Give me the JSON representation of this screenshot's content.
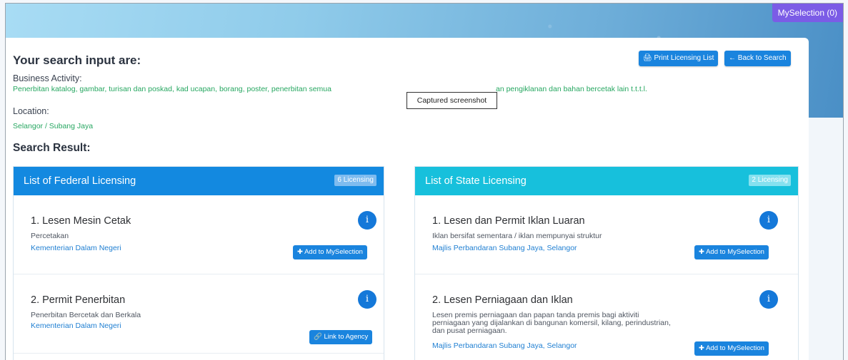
{
  "header": {
    "myselection": "MySelection (0)"
  },
  "search": {
    "title": "Your search input are:",
    "business_label": "Business Activity:",
    "business_value": "Penerbitan katalog, gambar, turisan dan poskad, kad ucapan, borang, poster, penerbitan semua",
    "business_value_end": "an pengiklanan dan bahan bercetak lain t.t.t.l.",
    "location_label": "Location:",
    "location_value": "Selangor / Subang Jaya",
    "print_button": "Print Licensing List",
    "back_button": "← Back to Search",
    "tooltip": "Captured screenshot",
    "result_title": "Search Result:"
  },
  "federal": {
    "title": "List of Federal Licensing",
    "count": "6 Licensing",
    "items": [
      {
        "name": "1. Lesen Mesin Cetak",
        "desc": "Percetakan",
        "agency": "Kementerian Dalam Negeri",
        "action": "Add to MySelection"
      },
      {
        "name": "2. Permit Penerbitan",
        "desc": "Penerbitan Bercetak dan Berkala",
        "agency": "Kementerian Dalam Negeri",
        "action": "Link to Agency"
      }
    ]
  },
  "state": {
    "title": "List of State Licensing",
    "count": "2 Licensing",
    "items": [
      {
        "name": "1. Lesen dan Permit Iklan Luaran",
        "desc": "Iklan bersifat sementara / iklan mempunyai struktur",
        "agency": "Majlis Perbandaran Subang Jaya, Selangor",
        "action": "Add to MySelection"
      },
      {
        "name": "2. Lesen Perniagaan dan Iklan",
        "desc": "Lesen premis perniagaan dan papan tanda premis bagi aktiviti perniagaan yang dijalankan di bangunan komersil, kilang, perindustrian, dan pusat perniagaan.",
        "agency": "Majlis Perbandaran Subang Jaya, Selangor",
        "action": "Add to MySelection"
      }
    ]
  },
  "icons": {
    "info": "info-icon",
    "print": "printer-icon",
    "plus": "plus-icon",
    "link": "link-icon"
  }
}
